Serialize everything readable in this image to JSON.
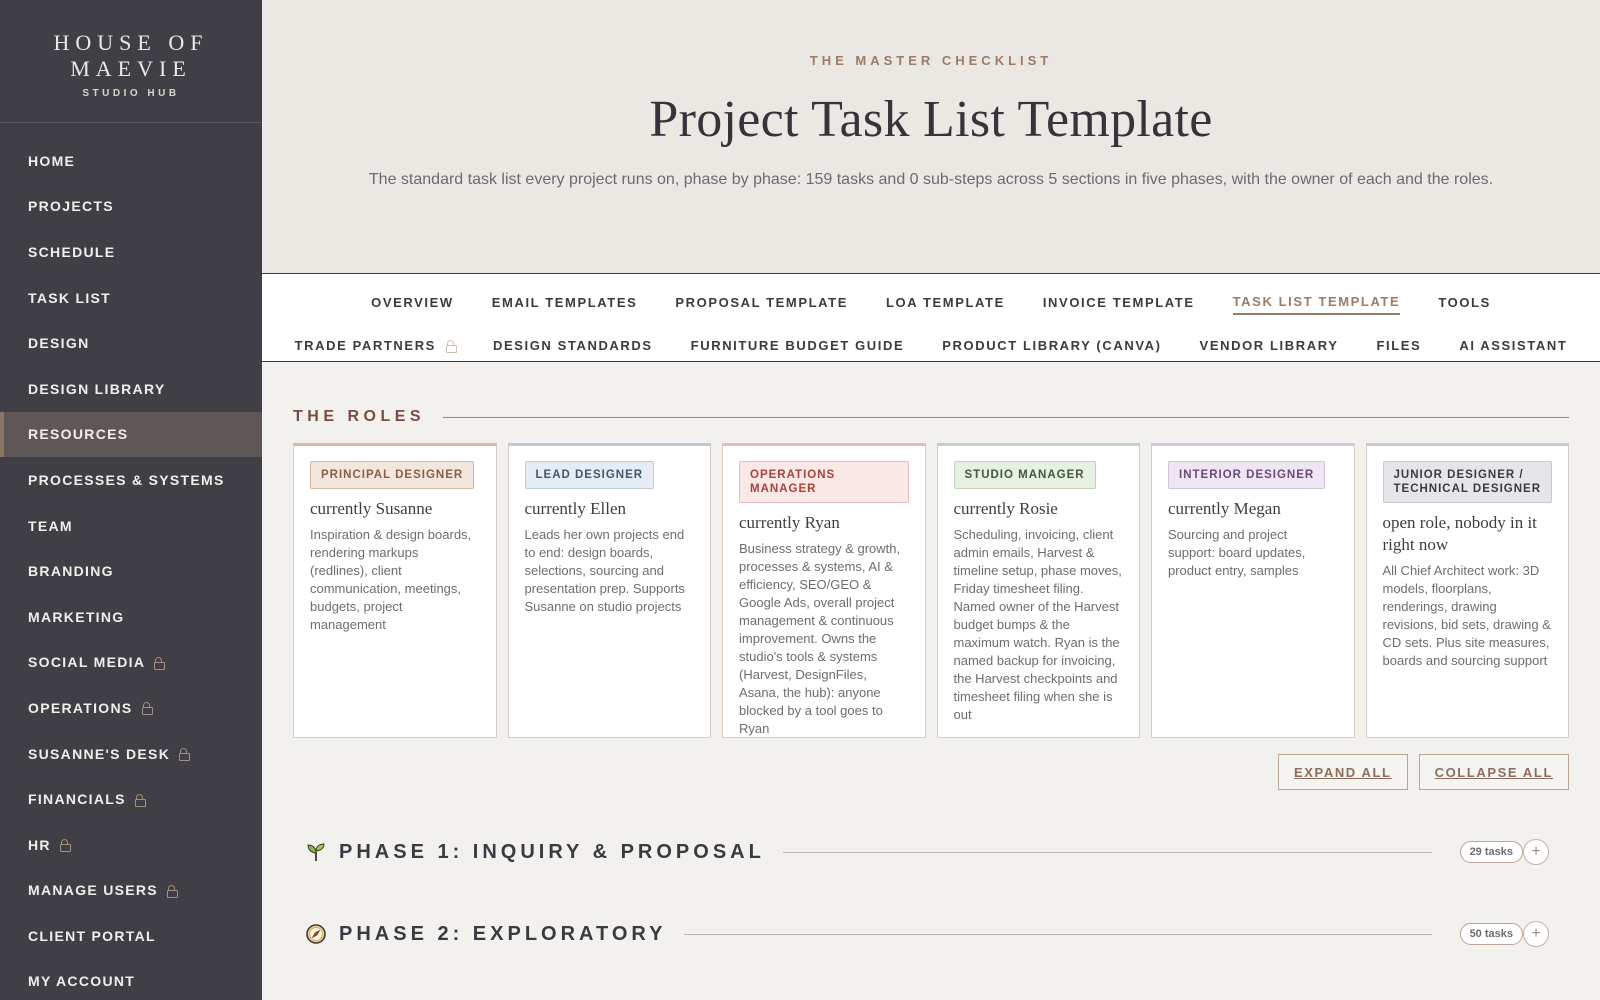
{
  "brand": {
    "name": "HOUSE OF MAEVIE",
    "sub": "STUDIO HUB"
  },
  "sidebar": {
    "items": [
      {
        "label": "HOME",
        "locked": false
      },
      {
        "label": "PROJECTS",
        "locked": false
      },
      {
        "label": "SCHEDULE",
        "locked": false
      },
      {
        "label": "TASK LIST",
        "locked": false
      },
      {
        "label": "DESIGN",
        "locked": false
      },
      {
        "label": "DESIGN LIBRARY",
        "locked": false
      },
      {
        "label": "RESOURCES",
        "locked": false,
        "active": true
      },
      {
        "label": "PROCESSES & SYSTEMS",
        "locked": false
      },
      {
        "label": "TEAM",
        "locked": false
      },
      {
        "label": "BRANDING",
        "locked": false
      },
      {
        "label": "MARKETING",
        "locked": false
      },
      {
        "label": "SOCIAL MEDIA",
        "locked": true
      },
      {
        "label": "OPERATIONS",
        "locked": true
      },
      {
        "label": "SUSANNE'S DESK",
        "locked": true
      },
      {
        "label": "FINANCIALS",
        "locked": true
      },
      {
        "label": "HR",
        "locked": true
      },
      {
        "label": "MANAGE USERS",
        "locked": true
      },
      {
        "label": "CLIENT PORTAL",
        "locked": false
      },
      {
        "label": "MY ACCOUNT",
        "locked": false
      }
    ]
  },
  "hero": {
    "eyebrow": "THE MASTER CHECKLIST",
    "title": "Project Task List Template",
    "subtitle": "The standard task list every project runs on, phase by phase: 159 tasks and 0 sub-steps across 5 sections in five phases, with the owner of each and the roles."
  },
  "tabs": {
    "row1": [
      {
        "label": "OVERVIEW"
      },
      {
        "label": "EMAIL TEMPLATES"
      },
      {
        "label": "PROPOSAL TEMPLATE"
      },
      {
        "label": "LOA TEMPLATE"
      },
      {
        "label": "INVOICE TEMPLATE"
      },
      {
        "label": "TASK LIST TEMPLATE",
        "active": true
      },
      {
        "label": "TOOLS"
      }
    ],
    "row2": [
      {
        "label": "TRADE PARTNERS",
        "locked": true
      },
      {
        "label": "DESIGN STANDARDS"
      },
      {
        "label": "FURNITURE BUDGET GUIDE"
      },
      {
        "label": "PRODUCT LIBRARY (CANVA)"
      },
      {
        "label": "VENDOR LIBRARY"
      },
      {
        "label": "FILES"
      },
      {
        "label": "AI ASSISTANT"
      }
    ]
  },
  "roles": {
    "heading": "THE ROLES",
    "cards": [
      {
        "role": "PRINCIPAL DESIGNER",
        "person": "currently Susanne",
        "desc": "Inspiration & design boards, rendering markups (redlines), client communication, meetings, budgets, project management",
        "accent": "#d7b9a0",
        "badge_bg": "#f3e6dc",
        "badge_text": "#8a5f4a"
      },
      {
        "role": "LEAD DESIGNER",
        "person": "currently Ellen",
        "desc": "Leads her own projects end to end: design boards, selections, sourcing and presentation prep. Supports Susanne on studio projects",
        "accent": "#bccbd8",
        "badge_bg": "#e5ecf3",
        "badge_text": "#44566a"
      },
      {
        "role": "OPERATIONS MANAGER",
        "person": "currently Ryan",
        "desc": "Business strategy & growth, processes & systems, AI & efficiency, SEO/GEO & Google Ads, overall project management & continuous improvement. Owns the studio's tools & systems (Harvest, DesignFiles, Asana, the hub): anyone blocked by a tool goes to Ryan",
        "accent": "#e6bcb8",
        "badge_bg": "#fae8e6",
        "badge_text": "#a6433b"
      },
      {
        "role": "STUDIO MANAGER",
        "person": "currently Rosie",
        "desc": "Scheduling, invoicing, client admin emails, Harvest & timeline setup, phase moves, Friday timesheet filing. Named owner of the Harvest budget bumps & the maximum watch. Ryan is the named backup for invoicing, the Harvest checkpoints and timesheet filing when she is out",
        "accent": "#c2d3bd",
        "badge_bg": "#e7f0e3",
        "badge_text": "#3f5a39"
      },
      {
        "role": "INTERIOR DESIGNER",
        "person": "currently Megan",
        "desc": "Sourcing and project support: board updates, product entry, samples",
        "accent": "#d3c4dc",
        "badge_bg": "#efe6f3",
        "badge_text": "#6a4a7a"
      },
      {
        "role": "JUNIOR DESIGNER / TECHNICAL DESIGNER",
        "person": "open role, nobody in it right now",
        "desc": "All Chief Architect work: 3D models, floorplans, renderings, drawing revisions, bid sets, drawing & CD sets. Plus site measures, boards and sourcing support",
        "accent": "#c9c9cf",
        "badge_bg": "#e6e6ea",
        "badge_text": "#3b3a40"
      }
    ]
  },
  "actions": {
    "expand": "EXPAND ALL",
    "collapse": "COLLAPSE ALL"
  },
  "phases": [
    {
      "title": "PHASE 1: INQUIRY & PROPOSAL",
      "count": "29 tasks",
      "icon": "sprout-icon"
    },
    {
      "title": "PHASE 2: EXPLORATORY",
      "count": "50 tasks",
      "icon": "compass-icon"
    }
  ]
}
